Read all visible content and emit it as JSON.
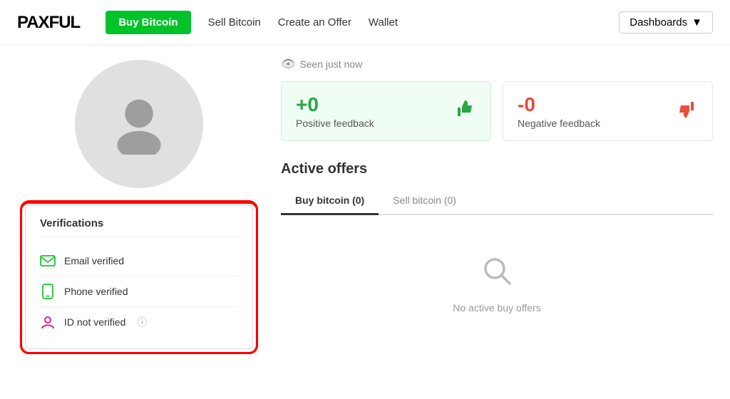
{
  "header": {
    "logo": "PAXFUL",
    "buy_bitcoin_label": "Buy Bitcoin",
    "sell_bitcoin_label": "Sell Bitcoin",
    "create_offer_label": "Create an Offer",
    "wallet_label": "Wallet",
    "dashboards_label": "Dashboards"
  },
  "profile": {
    "seen_label": "Seen just now",
    "positive_feedback_number": "+0",
    "positive_feedback_label": "Positive feedback",
    "negative_feedback_number": "-0",
    "negative_feedback_label": "Negative feedback"
  },
  "verifications": {
    "title": "Verifications",
    "items": [
      {
        "label": "Email verified",
        "status": "verified",
        "icon": "email"
      },
      {
        "label": "Phone verified",
        "status": "verified",
        "icon": "phone"
      },
      {
        "label": "ID not verified",
        "status": "not_verified",
        "icon": "id"
      }
    ]
  },
  "active_offers": {
    "title": "Active offers",
    "tabs": [
      {
        "label": "Buy bitcoin (0)",
        "active": true
      },
      {
        "label": "Sell bitcoin (0)",
        "active": false
      }
    ],
    "no_offers_text": "No active buy offers"
  }
}
